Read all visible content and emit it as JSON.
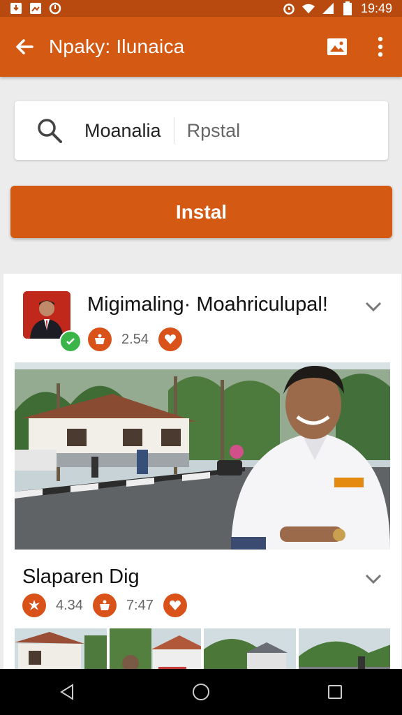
{
  "status_bar": {
    "time": "19:49",
    "left_icons": [
      "download-icon",
      "image-icon",
      "sync-icon"
    ],
    "right_icons": [
      "alarm-icon",
      "wifi-icon",
      "signal-icon",
      "battery-icon"
    ]
  },
  "app_bar": {
    "title": "Npaky: Ilunaica",
    "icons": [
      "back-arrow-icon",
      "gallery-icon",
      "more-vert-icon"
    ]
  },
  "search": {
    "value": "Moanalia",
    "placeholder": "Rpstal"
  },
  "install_button": {
    "label": "Instal"
  },
  "post": {
    "title": "Migimaling· Moahriculupal!",
    "likes": "2.54",
    "icons": [
      "pot-icon",
      "heart-icon",
      "chevron-down-icon"
    ]
  },
  "section": {
    "title": "Slaparen Dig",
    "stat1": "4.34",
    "stat2": "7:47",
    "icons": [
      "leaf-icon",
      "pot-icon",
      "heart-icon",
      "chevron-down-icon"
    ]
  },
  "colors": {
    "status_bar": "#b94a0f",
    "app_bar": "#d45a13",
    "accent": "#d8521a",
    "verified": "#3bb54a"
  },
  "nav_bar": {
    "icons": [
      "back-triangle-icon",
      "home-circle-icon",
      "recents-square-icon"
    ]
  }
}
